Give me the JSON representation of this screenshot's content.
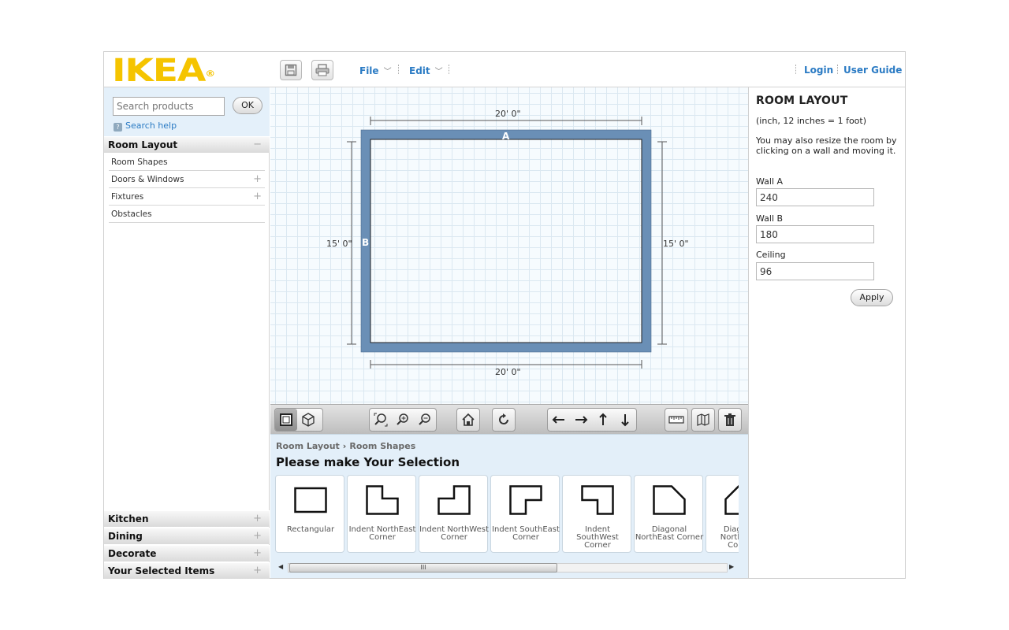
{
  "header": {
    "logo_text": "IKEA",
    "logo_reg": "®",
    "file_menu": "File",
    "edit_menu": "Edit",
    "login": "Login",
    "user_guide": "User Guide"
  },
  "search": {
    "placeholder": "Search products",
    "ok_label": "OK",
    "help_label": "Search help"
  },
  "sidebar": {
    "room_layout_header": "Room Layout",
    "room_layout_items": [
      "Room Shapes",
      "Doors & Windows",
      "Fixtures",
      "Obstacles"
    ],
    "bottom_categories": [
      "Kitchen",
      "Dining",
      "Decorate",
      "Your Selected Items"
    ]
  },
  "canvas": {
    "top_dimension": "20' 0\"",
    "bottom_dimension": "20' 0\"",
    "left_dimension": "15' 0\"",
    "right_dimension": "15' 0\"",
    "wall_a_marker": "A",
    "wall_b_marker": "B",
    "wall_color": "#6a8fb6"
  },
  "bottom": {
    "breadcrumb_root": "Room Layout",
    "breadcrumb_current": "Room Shapes",
    "title": "Please make Your Selection",
    "shapes": [
      {
        "label": "Rectangular",
        "icon": "rectangular-shape-icon"
      },
      {
        "label": "Indent NorthEast Corner",
        "icon": "indent-northeast-icon"
      },
      {
        "label": "Indent NorthWest Corner",
        "icon": "indent-northwest-icon"
      },
      {
        "label": "Indent SouthEast Corner",
        "icon": "indent-southeast-icon"
      },
      {
        "label": "Indent SouthWest Corner",
        "icon": "indent-southwest-icon"
      },
      {
        "label": "Diagonal NorthEast Corner",
        "icon": "diagonal-northeast-icon"
      },
      {
        "label": "Diagonal NorthWest Corner",
        "icon": "diagonal-northwest-icon"
      }
    ],
    "scroll_thumb": "III"
  },
  "right_panel": {
    "title": "ROOM LAYOUT",
    "units_note": "(inch, 12 inches = 1 foot)",
    "description": "You may also resize the room by clicking on a wall and moving it.",
    "wall_a_label": "Wall A",
    "wall_a_value": "240",
    "wall_b_label": "Wall B",
    "wall_b_value": "180",
    "ceiling_label": "Ceiling",
    "ceiling_value": "96",
    "apply_label": "Apply"
  },
  "colors": {
    "brand_yellow": "#f5c400",
    "link_blue": "#2b7bc4",
    "panel_blue": "#e3eff9"
  }
}
